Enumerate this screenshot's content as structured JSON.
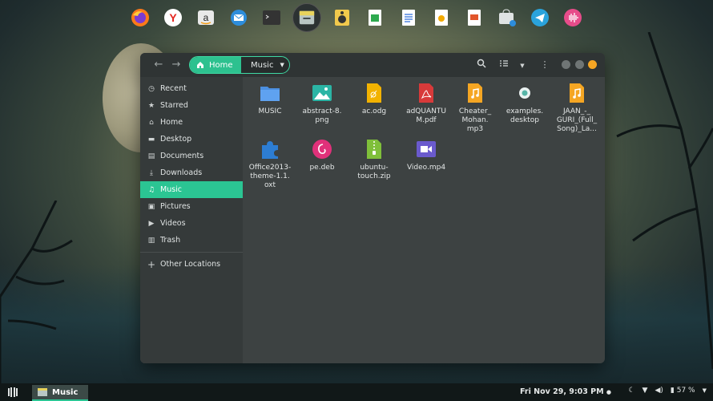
{
  "dock": {
    "items": [
      {
        "name": "firefox",
        "icon": "firefox-icon"
      },
      {
        "name": "yandex-browser",
        "icon": "yandex-icon"
      },
      {
        "name": "amazon",
        "icon": "amazon-icon"
      },
      {
        "name": "mail",
        "icon": "mail-icon"
      },
      {
        "name": "terminal",
        "icon": "terminal-icon"
      },
      {
        "name": "files",
        "icon": "files-icon"
      },
      {
        "name": "rhythmbox",
        "icon": "speaker-icon"
      },
      {
        "name": "calc",
        "icon": "spreadsheet-icon"
      },
      {
        "name": "writer",
        "icon": "document-icon"
      },
      {
        "name": "draw",
        "icon": "draw-icon"
      },
      {
        "name": "impress",
        "icon": "presentation-icon"
      },
      {
        "name": "software",
        "icon": "store-icon"
      },
      {
        "name": "telegram",
        "icon": "telegram-icon"
      },
      {
        "name": "audio-recorder",
        "icon": "waveform-icon"
      }
    ]
  },
  "window": {
    "pathbar": {
      "home_label": "Home",
      "current_label": "Music"
    },
    "sidebar": {
      "items": [
        {
          "label": "Recent",
          "icon": "clock-icon"
        },
        {
          "label": "Starred",
          "icon": "star-icon"
        },
        {
          "label": "Home",
          "icon": "home-icon"
        },
        {
          "label": "Desktop",
          "icon": "desktop-icon"
        },
        {
          "label": "Documents",
          "icon": "documents-icon"
        },
        {
          "label": "Downloads",
          "icon": "download-icon"
        },
        {
          "label": "Music",
          "icon": "music-icon",
          "active": true
        },
        {
          "label": "Pictures",
          "icon": "pictures-icon"
        },
        {
          "label": "Videos",
          "icon": "video-icon"
        },
        {
          "label": "Trash",
          "icon": "trash-icon"
        }
      ],
      "other_locations": "Other Locations"
    },
    "files": [
      {
        "name": "MUSIC",
        "type": "folder"
      },
      {
        "name": "abstract-8.\npng",
        "type": "image"
      },
      {
        "name": "ac.odg",
        "type": "drawing"
      },
      {
        "name": "adQUANTU\nM.pdf",
        "type": "pdf"
      },
      {
        "name": "Cheater_\nMohan.\nmp3",
        "type": "audio"
      },
      {
        "name": "examples.\ndesktop",
        "type": "desktop"
      },
      {
        "name": "JAAN_-_\nGURI_(Full_\nSong)_La...",
        "type": "audio"
      },
      {
        "name": "Office2013-\ntheme-1.1.\noxt",
        "type": "extension"
      },
      {
        "name": "pe.deb",
        "type": "deb"
      },
      {
        "name": "ubuntu-\ntouch.zip",
        "type": "zip"
      },
      {
        "name": "Video.mp4",
        "type": "video"
      }
    ]
  },
  "panel": {
    "task_label": "Music",
    "clock": "Fri Nov 29,  9:03 PM",
    "battery": "57 %"
  },
  "colors": {
    "accent": "#2bc593",
    "window_bg": "#3d4242",
    "sidebar_bg": "#353a3a",
    "headerbar_bg": "#2f3434"
  }
}
